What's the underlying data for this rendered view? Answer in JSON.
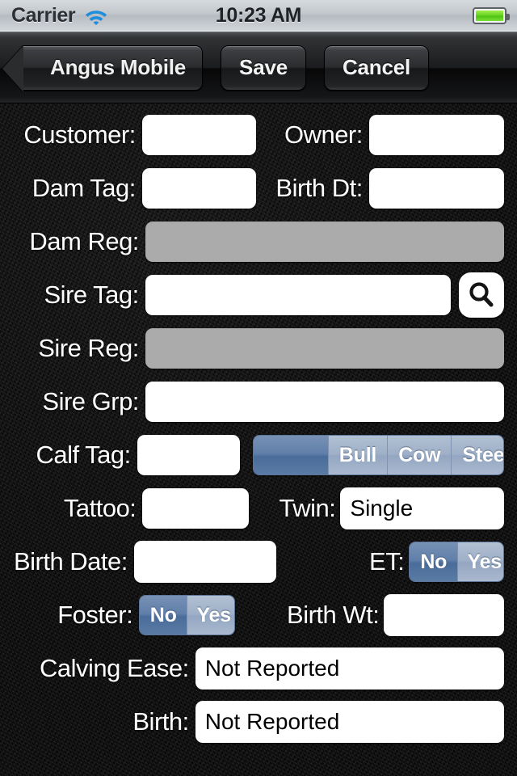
{
  "status_bar": {
    "carrier": "Carrier",
    "time": "10:23 AM",
    "wifi_icon": "wifi-icon",
    "battery_icon": "battery-full-icon"
  },
  "nav_bar": {
    "back_label": "Angus Mobile",
    "save_label": "Save",
    "cancel_label": "Cancel"
  },
  "form": {
    "rows": [
      {
        "label_left": "Customer:",
        "value_left": "",
        "label_right": "Owner:",
        "value_right": ""
      },
      {
        "label_left": "Dam Tag:",
        "value_left": "",
        "label_right": "Birth Dt:",
        "value_right": ""
      },
      {
        "label_left": "Dam Reg:",
        "value_left": ""
      },
      {
        "label_left": "Sire Tag:",
        "value_left": "",
        "search_icon": "search-icon"
      },
      {
        "label_left": "Sire Reg:",
        "value_left": ""
      },
      {
        "label_left": "Sire Grp:",
        "value_left": ""
      },
      {
        "label_left": "Calf Tag:",
        "value_left": ""
      },
      {
        "label_left": "Tattoo:",
        "value_left": "",
        "label_right": "Twin:",
        "value_right": "Single"
      },
      {
        "label_left": "Birth Date:",
        "value_left": "",
        "label_right": "ET:"
      },
      {
        "label_left": "Foster:",
        "label_right": "Birth Wt:",
        "value_right": ""
      },
      {
        "label_left": "Calving Ease:",
        "value_left": "Not Reported"
      },
      {
        "label_left": "Birth:",
        "value_left": "Not Reported"
      }
    ],
    "sex_segmented": {
      "options": [
        "",
        "Bull",
        "Cow",
        "Steer"
      ],
      "selected_index": 0
    },
    "et_segmented": {
      "options": [
        "No",
        "Yes"
      ],
      "selected_index": 0
    },
    "foster_segmented": {
      "options": [
        "No",
        "Yes"
      ],
      "selected_index": 0
    }
  },
  "colors": {
    "segment_selected": "#4a6c9a",
    "segment_unselected": "#9eafc7",
    "field_disabled": "#ababab",
    "battery_green": "#66d420"
  }
}
